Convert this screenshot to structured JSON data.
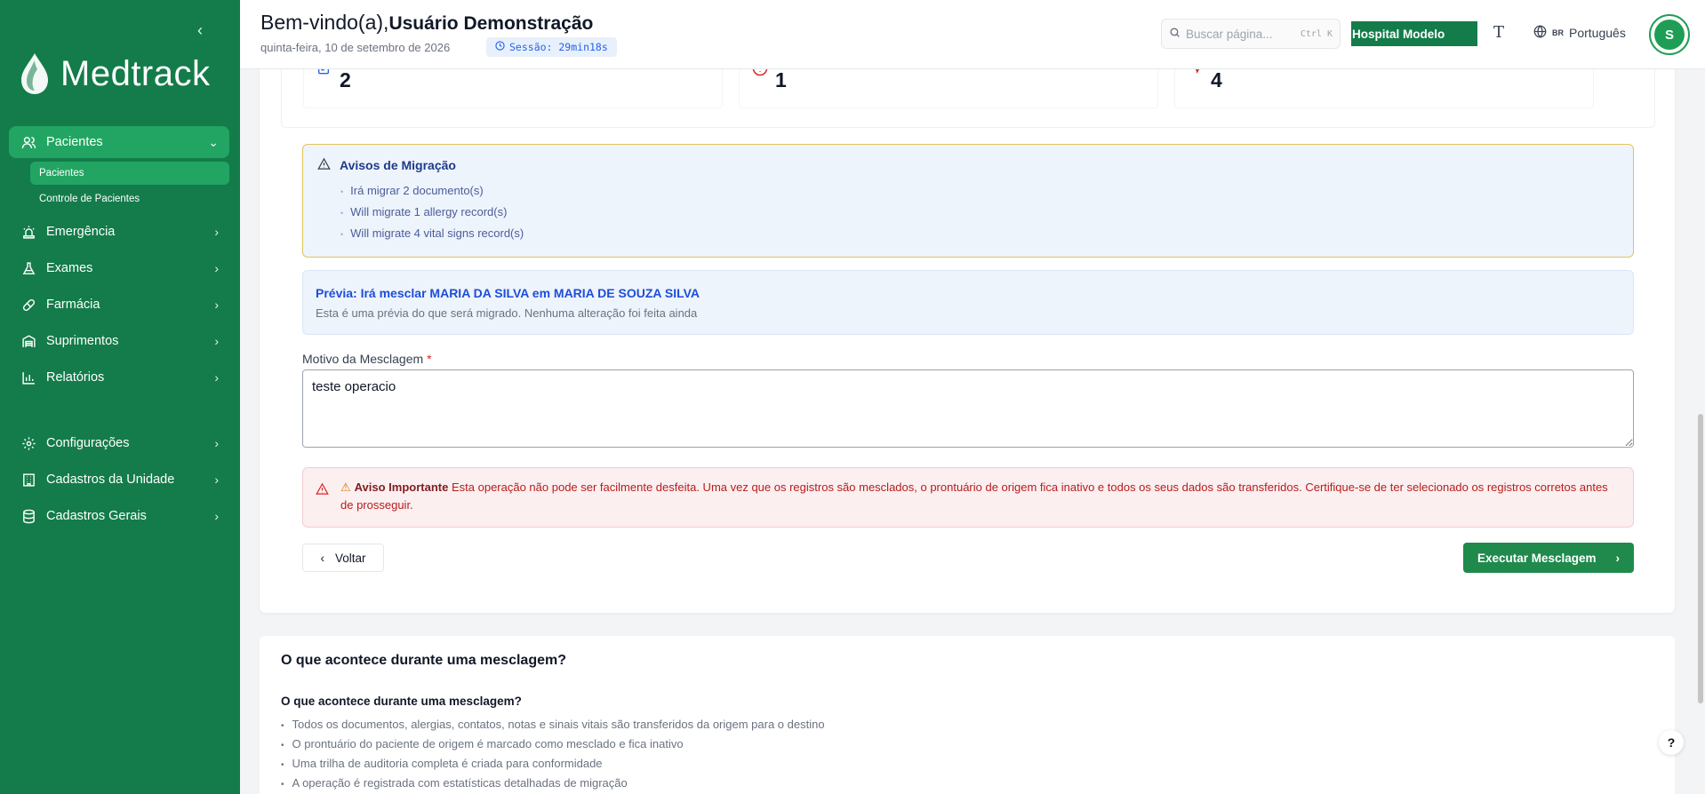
{
  "sidebar": {
    "brand": "Medtrack",
    "collapse_icon": "chevron-left-icon",
    "items": [
      {
        "label": "Pacientes",
        "icon": "users-icon",
        "active": true,
        "expanded": true
      },
      {
        "label": "Emergência",
        "icon": "siren-icon"
      },
      {
        "label": "Exames",
        "icon": "flask-icon"
      },
      {
        "label": "Farmácia",
        "icon": "pill-icon"
      },
      {
        "label": "Suprimentos",
        "icon": "warehouse-icon"
      },
      {
        "label": "Relatórios",
        "icon": "bar-chart-icon"
      },
      {
        "label": "Configurações",
        "icon": "gear-icon"
      },
      {
        "label": "Cadastros da Unidade",
        "icon": "building-icon"
      },
      {
        "label": "Cadastros Gerais",
        "icon": "database-icon"
      }
    ],
    "subitems": [
      {
        "label": "Pacientes",
        "active": true
      },
      {
        "label": "Controle de Pacientes"
      }
    ]
  },
  "header": {
    "welcome_prefix": "Bem-vindo(a),",
    "user_name": "Usuário Demonstração",
    "date": "quinta-feira, 10 de setembro de 2026",
    "session": "Sessão: 29min18s",
    "search_placeholder": "Buscar página...",
    "search_shortcut": "Ctrl K",
    "hospital": "Hospital Modelo",
    "font_toggle": "T",
    "lang_flag": "BR",
    "language": "Português",
    "avatar_initial": "S"
  },
  "stats": [
    {
      "icon": "document-icon",
      "value": "2",
      "color": "#2563eb"
    },
    {
      "icon": "alert-circle-icon",
      "value": "1",
      "color": "#dc2626"
    },
    {
      "icon": "heartbeat-icon",
      "value": "4",
      "color": "#dc2626"
    }
  ],
  "migration_warnings": {
    "title": "Avisos de Migração",
    "items": [
      "Irá migrar 2 documento(s)",
      "Will migrate 1 allergy record(s)",
      "Will migrate 4 vital signs record(s)"
    ]
  },
  "preview": {
    "title": "Prévia: Irá mesclar MARIA DA SILVA em MARIA DE SOUZA SILVA",
    "subtitle": "Esta é uma prévia do que será migrado. Nenhuma alteração foi feita ainda"
  },
  "reason": {
    "label": "Motivo da Mesclagem",
    "required_mark": "*",
    "value": "teste operacio"
  },
  "important": {
    "title": "Aviso Importante",
    "text": "Esta operação não pode ser facilmente desfeita. Uma vez que os registros são mesclados, o prontuário de origem fica inativo e todos os seus dados são transferidos. Certifique-se de ter selecionado os registros corretos antes de prosseguir."
  },
  "actions": {
    "back": "Voltar",
    "execute": "Executar Mesclagem"
  },
  "info": {
    "title": "O que acontece durante uma mesclagem?",
    "subtitle": "O que acontece durante uma mesclagem?",
    "items": [
      "Todos os documentos, alergias, contatos, notas e sinais vitais são transferidos da origem para o destino",
      "O prontuário do paciente de origem é marcado como mesclado e fica inativo",
      "Uma trilha de auditoria completa é criada para conformidade",
      "A operação é registrada com estatísticas detalhadas de migração"
    ]
  },
  "help_label": "?",
  "colors": {
    "sidebar": "#137c4a",
    "accent": "#1f8a4c",
    "danger": "#dc2626",
    "info_blue": "#1d4ed8"
  }
}
